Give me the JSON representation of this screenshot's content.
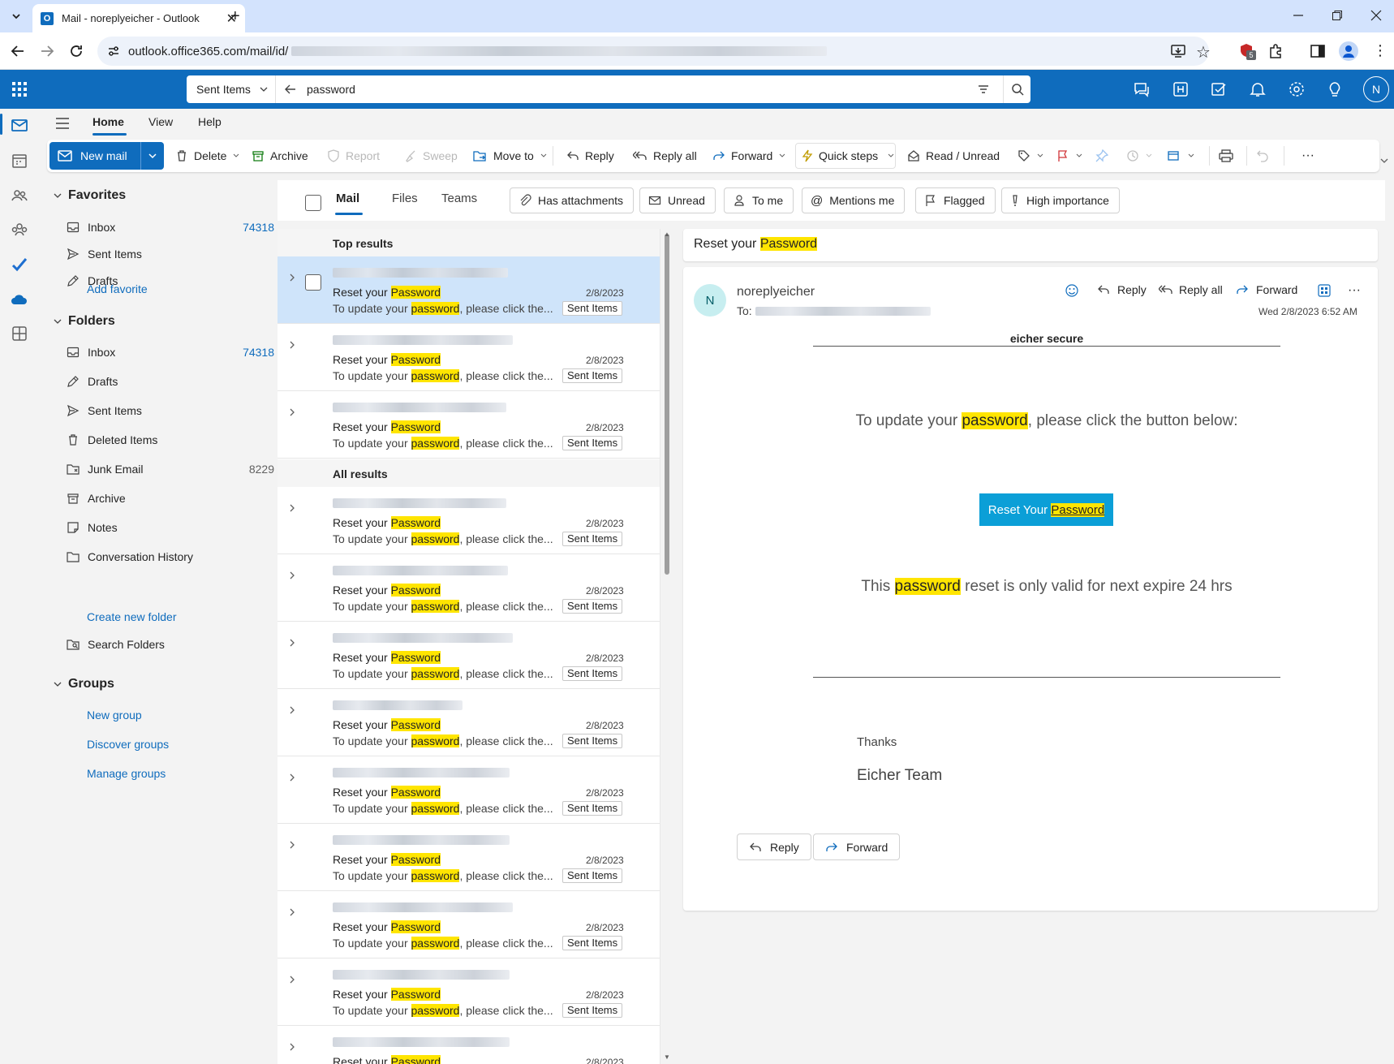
{
  "browser": {
    "tab_title": "Mail - noreplyeicher - Outlook",
    "url": "outlook.office365.com/mail/id/",
    "ext_badge": "5"
  },
  "appbar": {
    "search_scope": "Sent Items",
    "search_query": "password",
    "avatar_initial": "N"
  },
  "ribbon": {
    "tabs": [
      "Home",
      "View",
      "Help"
    ],
    "new_mail": "New mail",
    "delete": "Delete",
    "archive": "Archive",
    "report": "Report",
    "sweep": "Sweep",
    "move_to": "Move to",
    "reply": "Reply",
    "reply_all": "Reply all",
    "forward": "Forward",
    "quick_steps": "Quick steps",
    "read_unread": "Read / Unread",
    "more": "···"
  },
  "nav": {
    "favorites_header": "Favorites",
    "favorites": [
      {
        "label": "Inbox",
        "count": "74318"
      },
      {
        "label": "Sent Items",
        "count": ""
      },
      {
        "label": "Drafts",
        "count": ""
      }
    ],
    "add_favorite": "Add favorite",
    "folders_header": "Folders",
    "folders": [
      {
        "label": "Inbox",
        "count": "74318"
      },
      {
        "label": "Drafts",
        "count": ""
      },
      {
        "label": "Sent Items",
        "count": ""
      },
      {
        "label": "Deleted Items",
        "count": ""
      },
      {
        "label": "Junk Email",
        "count": "8229"
      },
      {
        "label": "Archive",
        "count": ""
      },
      {
        "label": "Notes",
        "count": ""
      },
      {
        "label": "Conversation History",
        "count": ""
      }
    ],
    "create_new_folder": "Create new folder",
    "search_folders": "Search Folders",
    "groups_header": "Groups",
    "groups_links": [
      "New group",
      "Discover groups",
      "Manage groups"
    ]
  },
  "filters": {
    "tabs": [
      "Mail",
      "Files",
      "Teams"
    ],
    "chips": [
      "Has attachments",
      "Unread",
      "To me",
      "Mentions me",
      "Flagged",
      "High importance"
    ]
  },
  "list": {
    "top_results": "Top results",
    "all_results": "All results",
    "subject_prefix": "Reset your ",
    "subject_hl": "Password",
    "preview_prefix": "To update your ",
    "preview_hl": "password",
    "preview_suffix": ", please click the...",
    "date": "2/8/2023",
    "folder": "Sent Items"
  },
  "reading": {
    "header_prefix": "Reset your ",
    "header_hl": "Password",
    "sender_initial": "N",
    "sender": "noreplyeicher",
    "to_label": "To:",
    "reply": "Reply",
    "reply_all": "Reply all",
    "forward": "Forward",
    "datetime": "Wed 2/8/2023 6:52 AM",
    "brand": "eicher secure",
    "para1_a": "To update your ",
    "para1_hl": "password",
    "para1_b": ", please click the button below:",
    "cta_a": "Reset Your ",
    "cta_hl": "Password",
    "para2_a": "This ",
    "para2_hl": "password",
    "para2_b": " reset is only valid for next expire 24 hrs",
    "thanks": "Thanks",
    "team": "Eicher Team",
    "btn_reply": "Reply",
    "btn_forward": "Forward"
  }
}
